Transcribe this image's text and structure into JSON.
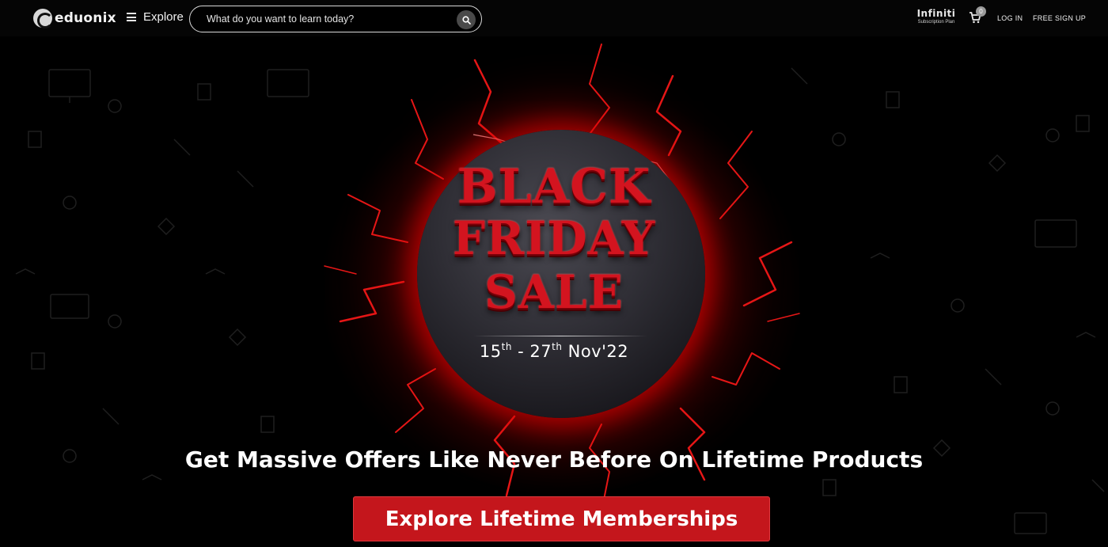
{
  "header": {
    "logo_text": "eduonix",
    "explore_label": "Explore",
    "search_placeholder": "What do you want to learn today?",
    "infiniti_name": "Infiniti",
    "infiniti_sub": "Subscription Plan",
    "cart_count": "0",
    "login_label": "LOG IN",
    "signup_label": "FREE SIGN UP"
  },
  "hero": {
    "title_line1": "BLACK",
    "title_line2": "FRIDAY",
    "title_line3": "SALE",
    "date_start_day": "15",
    "date_start_suffix": "th",
    "date_separator": " - ",
    "date_end_day": "27",
    "date_end_suffix": "th",
    "date_month_year": "Nov'22",
    "tagline": "Get Massive Offers Like Never Before On Lifetime Products",
    "cta_label": "Explore Lifetime Memberships"
  },
  "colors": {
    "accent_red": "#c4161c",
    "title_red": "#d3141f",
    "background": "#000000"
  },
  "icons": [
    "logo-mark-icon",
    "hamburger-icon",
    "search-icon",
    "infiniti-logo-icon",
    "cart-icon"
  ]
}
